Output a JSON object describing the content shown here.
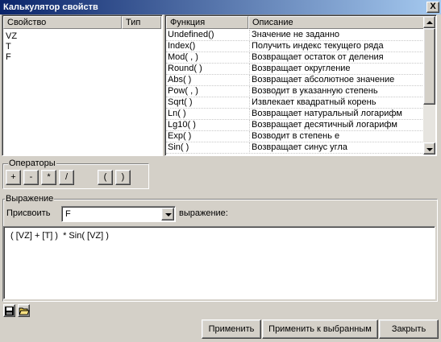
{
  "window": {
    "title": "Калькулятор свойств",
    "close_label": "X"
  },
  "properties": {
    "headers": [
      "Свойство",
      "Тип"
    ],
    "items": [
      "VZ",
      "T",
      "F"
    ]
  },
  "functions": {
    "headers": [
      "Функция",
      "Описание"
    ],
    "rows": [
      [
        "Undefined()",
        "Значение не заданно"
      ],
      [
        "Index()",
        "Получить индекс текущего ряда"
      ],
      [
        "Mod( , )",
        "Возвращает остаток от деления"
      ],
      [
        "Round( )",
        "Возвращает округление"
      ],
      [
        "Abs( )",
        "Возвращает абсолютное значение"
      ],
      [
        "Pow( , )",
        "Возводит в указанную степень"
      ],
      [
        "Sqrt( )",
        "Извлекает квадратный корень"
      ],
      [
        "Ln( )",
        "Возвращает натуральный логарифм"
      ],
      [
        "Lg10( )",
        "Возвращает десятичный логарифм"
      ],
      [
        "Exp( )",
        "Возводит в степень е"
      ],
      [
        "Sin( )",
        "Возвращает синус угла"
      ]
    ]
  },
  "operators": {
    "label": "Операторы",
    "buttons": [
      "+",
      "-",
      "*",
      "/",
      "(",
      ")"
    ]
  },
  "expression": {
    "label": "Выражение",
    "assign_label": "Присвоить",
    "target_value": "F",
    "expr_label": "выражение:",
    "text": "( [VZ] + [T] )  * Sin( [VZ] )"
  },
  "icons": [
    "save-icon",
    "open-folder-icon"
  ],
  "actions": {
    "apply": "Применить",
    "apply_selected": "Применить к выбранным",
    "close": "Закрыть"
  }
}
